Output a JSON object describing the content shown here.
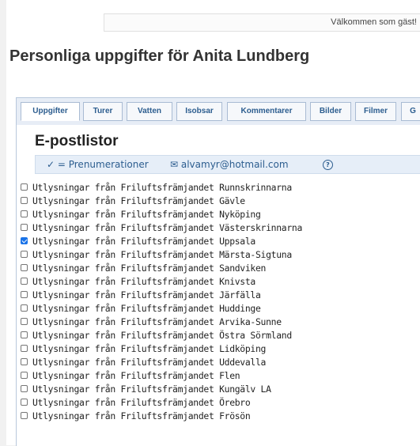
{
  "header": {
    "welcome": "Välkommen som gäst!"
  },
  "page": {
    "title": "Personliga uppgifter för Anita Lundberg"
  },
  "tabs": [
    {
      "label": "Uppgifter"
    },
    {
      "label": "Turer"
    },
    {
      "label": "Vatten"
    },
    {
      "label": "Isobsar"
    },
    {
      "label": "Kommentarer"
    },
    {
      "label": "Bilder"
    },
    {
      "label": "Filmer"
    },
    {
      "label": "G"
    }
  ],
  "section": {
    "title": "E-postlistor",
    "legend": "✓ = Prenumerationer",
    "email": "✉ alvamyr@hotmail.com",
    "help": "?"
  },
  "lists": [
    {
      "label": "Utlysningar från Friluftsfrämjandet Runnskrinnarna",
      "checked": false
    },
    {
      "label": "Utlysningar från Friluftsfrämjandet Gävle",
      "checked": false
    },
    {
      "label": "Utlysningar från Friluftsfrämjandet Nyköping",
      "checked": false
    },
    {
      "label": "Utlysningar från Friluftsfrämjandet Västerskrinnarna",
      "checked": false
    },
    {
      "label": "Utlysningar från Friluftsfrämjandet Uppsala",
      "checked": true
    },
    {
      "label": "Utlysningar från Friluftsfrämjandet Märsta-Sigtuna",
      "checked": false
    },
    {
      "label": "Utlysningar från Friluftsfrämjandet Sandviken",
      "checked": false
    },
    {
      "label": "Utlysningar från Friluftsfrämjandet Knivsta",
      "checked": false
    },
    {
      "label": "Utlysningar från Friluftsfrämjandet Järfälla",
      "checked": false
    },
    {
      "label": "Utlysningar från Friluftsfrämjandet Huddinge",
      "checked": false
    },
    {
      "label": "Utlysningar från Friluftsfrämjandet Arvika-Sunne",
      "checked": false
    },
    {
      "label": "Utlysningar från Friluftsfrämjandet Östra Sörmland",
      "checked": false
    },
    {
      "label": "Utlysningar från Friluftsfrämjandet Lidköping",
      "checked": false
    },
    {
      "label": "Utlysningar från Friluftsfrämjandet Uddevalla",
      "checked": false
    },
    {
      "label": "Utlysningar från Friluftsfrämjandet Flen",
      "checked": false
    },
    {
      "label": "Utlysningar från Friluftsfrämjandet Kungälv LA",
      "checked": false
    },
    {
      "label": "Utlysningar från Friluftsfrämjandet Örebro",
      "checked": false
    },
    {
      "label": "Utlysningar från Friluftsfrämjandet Frösön",
      "checked": false
    }
  ]
}
